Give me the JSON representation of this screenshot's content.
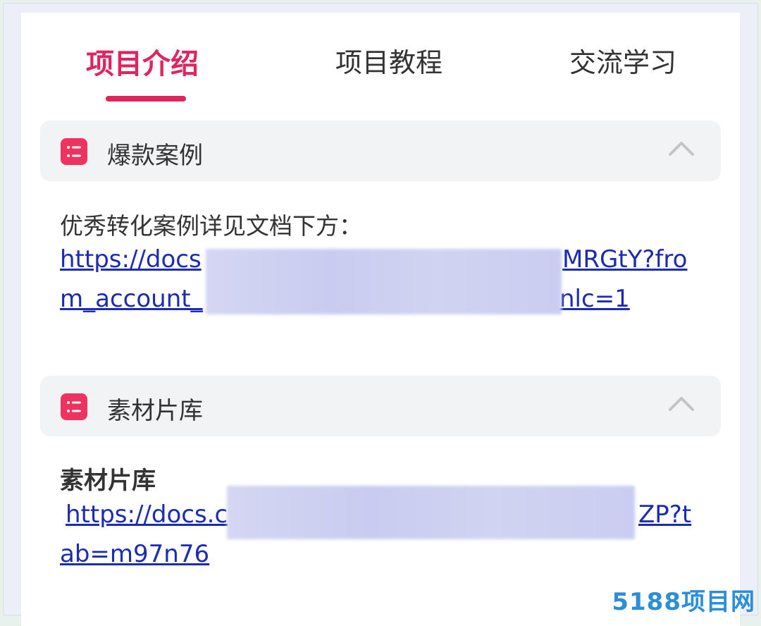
{
  "tabs": [
    {
      "label": "项目介绍",
      "active": true
    },
    {
      "label": "项目教程",
      "active": false
    },
    {
      "label": "交流学习",
      "active": false
    }
  ],
  "sections": [
    {
      "title": "爆款案例",
      "content": {
        "intro": "优秀转化案例详见文档下方：",
        "link_line_1": "https://docs",
        "link_line_1_tail": "MRGtY?fro",
        "link_line_2": "m_account_",
        "link_line_2_tail": "nlc=1"
      }
    },
    {
      "title": "素材片库",
      "content": {
        "heading": "素材片库",
        "link_line_1": "https://docs.c",
        "link_line_1_tail": "ZP?t",
        "link_line_2": "ab=m97n76"
      }
    }
  ],
  "watermark": "5188项目网",
  "colors": {
    "accent": "#e0245e",
    "link": "#1a2bb5",
    "header_bg": "#f2f3f5"
  },
  "icons": {
    "section_icon": "list-icon",
    "collapse_icon": "chevron-up-icon"
  }
}
